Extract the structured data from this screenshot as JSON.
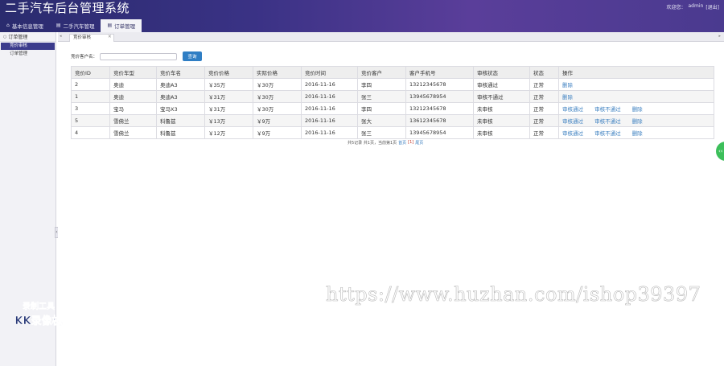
{
  "header": {
    "title": "二手汽车后台管理系统",
    "welcome": "欢迎您：",
    "username": "admin",
    "logout": "[退出]"
  },
  "main_nav": [
    {
      "label": "基本信息管理",
      "icon": "home-icon",
      "active": false
    },
    {
      "label": "二手汽车管理",
      "icon": "list-icon",
      "active": false
    },
    {
      "label": "订单管理",
      "icon": "list-icon",
      "active": true
    }
  ],
  "sidebar": {
    "group_label": "订单管理",
    "items": [
      {
        "label": "竞价审核",
        "active": true
      },
      {
        "label": "订单管理",
        "active": false
      }
    ]
  },
  "content_tab": {
    "label": "竞价审核",
    "close": "✕"
  },
  "search": {
    "label": "竞价客户名：",
    "value": "",
    "placeholder": "",
    "button_label": "查询"
  },
  "table": {
    "columns": [
      "竞价ID",
      "竞价车型",
      "竞价车名",
      "竞价价格",
      "实际价格",
      "竞价时间",
      "竞价客户",
      "客户手机号",
      "审核状态",
      "状态",
      "操作"
    ],
    "rows": [
      {
        "id": "2",
        "brand": "奥迪",
        "model": "奥迪A3",
        "bid_price": "￥35万",
        "actual_price": "￥30万",
        "time": "2016-11-16",
        "customer": "李四",
        "phone": "13212345678",
        "review": "审核通过",
        "status": "正常",
        "actions": [
          "删除"
        ]
      },
      {
        "id": "1",
        "brand": "奥迪",
        "model": "奥迪A3",
        "bid_price": "￥31万",
        "actual_price": "￥30万",
        "time": "2016-11-16",
        "customer": "张三",
        "phone": "13945678954",
        "review": "审核不通过",
        "status": "正常",
        "actions": [
          "删除"
        ]
      },
      {
        "id": "3",
        "brand": "宝马",
        "model": "宝马X3",
        "bid_price": "￥31万",
        "actual_price": "￥30万",
        "time": "2016-11-16",
        "customer": "李四",
        "phone": "13212345678",
        "review": "未审核",
        "status": "正常",
        "actions": [
          "审核通过",
          "审核不通过",
          "删除"
        ]
      },
      {
        "id": "5",
        "brand": "雪佛兰",
        "model": "科鲁兹",
        "bid_price": "￥13万",
        "actual_price": "￥9万",
        "time": "2016-11-16",
        "customer": "张大",
        "phone": "13612345678",
        "review": "未审核",
        "status": "正常",
        "actions": [
          "审核通过",
          "审核不通过",
          "删除"
        ]
      },
      {
        "id": "4",
        "brand": "雪佛兰",
        "model": "科鲁兹",
        "bid_price": "￥12万",
        "actual_price": "￥9万",
        "time": "2016-11-16",
        "customer": "张三",
        "phone": "13945678954",
        "review": "未审核",
        "status": "正常",
        "actions": [
          "审核通过",
          "审核不通过",
          "删除"
        ]
      }
    ]
  },
  "pagination": {
    "summary": "共5记录 共1页，当前第1页",
    "first": "首页",
    "current": "[1]",
    "last": "尾页"
  },
  "watermarks": {
    "url": "https://www.huzhan.com/ishop39397",
    "logo_line1": "录制工具",
    "logo_line2": "KK录像机"
  },
  "float_button": {
    "label": "‹‹"
  },
  "colors": {
    "header_start": "#2a2b6e",
    "header_end": "#5a3e9a",
    "accent": "#2f7ec4",
    "link": "#3b7fc0",
    "sidebar_active": "#3b3b8c"
  }
}
